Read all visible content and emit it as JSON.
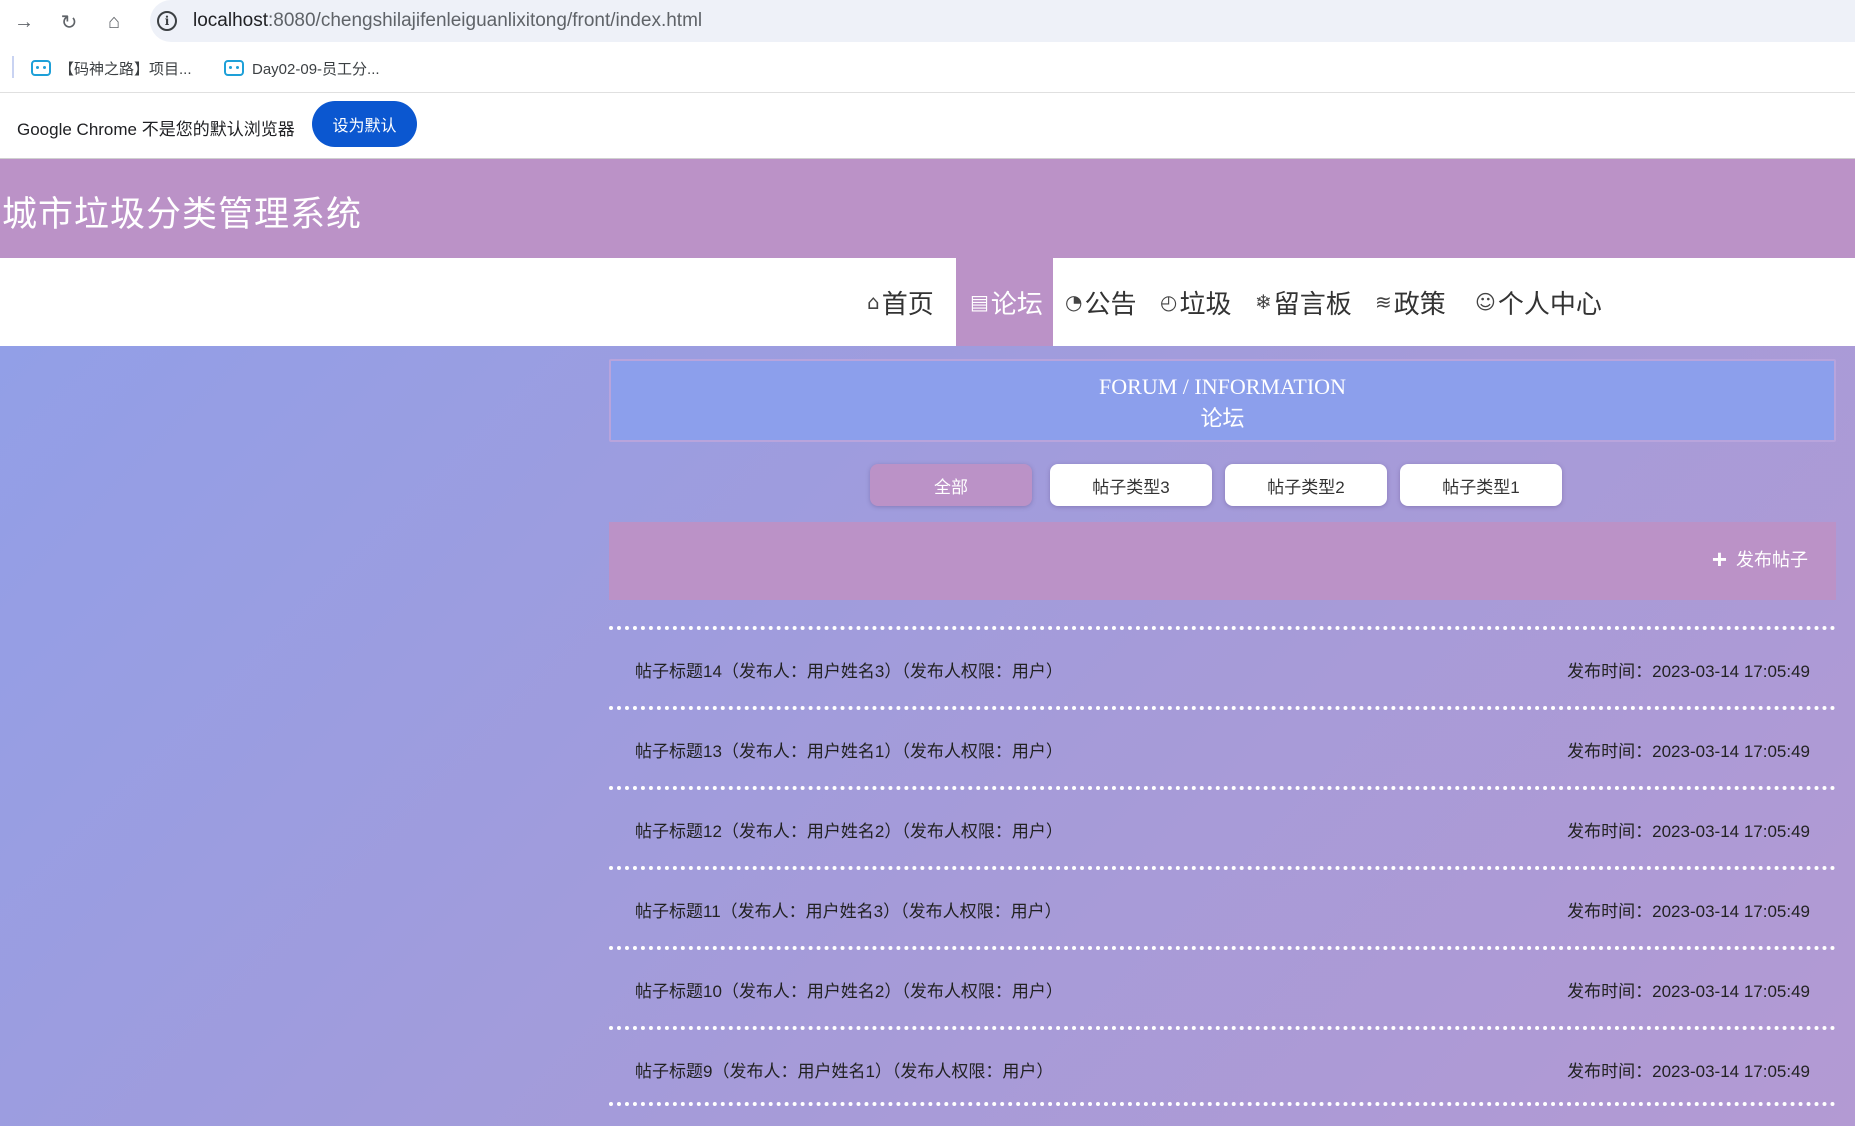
{
  "browser": {
    "url_host": "localhost",
    "url_path": ":8080/chengshilajifenleiguanlixitong/front/index.html",
    "nav_icons": [
      "forward-icon",
      "reload-icon",
      "home-icon",
      "info-icon"
    ],
    "bookmarks": [
      {
        "label": "【码神之路】项目..."
      },
      {
        "label": "Day02-09-员工分..."
      }
    ],
    "infobar_text": "Google Chrome 不是您的默认浏览器",
    "infobar_button": "设为默认"
  },
  "site": {
    "title": "城市垃圾分类管理系统",
    "accent_color": "#bb92c7",
    "nav": [
      {
        "icon": "⌂",
        "label": "首页"
      },
      {
        "icon": "📋",
        "label": "论坛",
        "active": true
      },
      {
        "icon": "◔",
        "label": "公告"
      },
      {
        "icon": "◴",
        "label": "垃圾"
      },
      {
        "icon": "❄",
        "label": "留言板"
      },
      {
        "icon": "≋",
        "label": "政策"
      },
      {
        "icon": "☺",
        "label": "个人中心"
      }
    ]
  },
  "banner": {
    "en": "FORUM / INFORMATION",
    "cn": "论坛"
  },
  "filters": [
    {
      "label": "全部",
      "active": true
    },
    {
      "label": "帖子类型3"
    },
    {
      "label": "帖子类型2"
    },
    {
      "label": "帖子类型1"
    }
  ],
  "publish_button": "发布帖子",
  "posts": [
    {
      "title": "帖子标题14（发布人：用户姓名3）（发布人权限：用户）",
      "time": "发布时间：2023-03-14 17:05:49"
    },
    {
      "title": "帖子标题13（发布人：用户姓名1）（发布人权限：用户）",
      "time": "发布时间：2023-03-14 17:05:49"
    },
    {
      "title": "帖子标题12（发布人：用户姓名2）（发布人权限：用户）",
      "time": "发布时间：2023-03-14 17:05:49"
    },
    {
      "title": "帖子标题11（发布人：用户姓名3）（发布人权限：用户）",
      "time": "发布时间：2023-03-14 17:05:49"
    },
    {
      "title": "帖子标题10（发布人：用户姓名2）（发布人权限：用户）",
      "time": "发布时间：2023-03-14 17:05:49"
    },
    {
      "title": "帖子标题9（发布人：用户姓名1）（发布人权限：用户）",
      "time": "发布时间：2023-03-14 17:05:49"
    }
  ]
}
